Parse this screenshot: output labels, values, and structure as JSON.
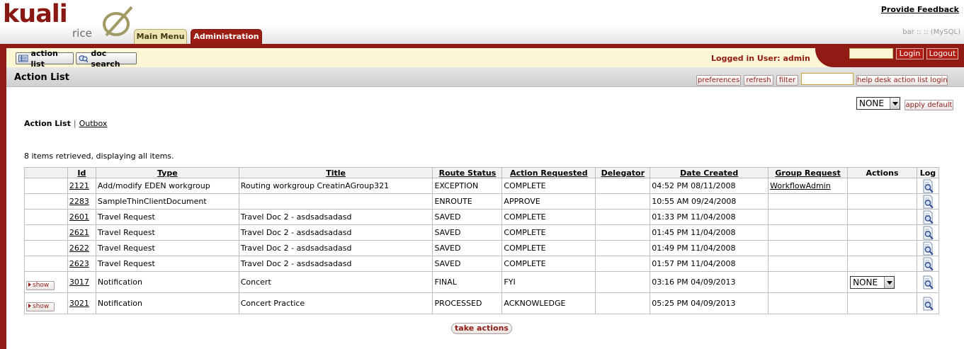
{
  "brand": {
    "name": "kuali",
    "suffix": "rice",
    "accent": "#8f1b14"
  },
  "header": {
    "feedback_link": "Provide Feedback",
    "environment": "bar :: :: (MySQL)",
    "tabs": [
      {
        "label": "Main Menu",
        "active": false
      },
      {
        "label": "Administration",
        "active": true
      }
    ]
  },
  "toolbar": {
    "action_list_button": "action list",
    "doc_search_button": "doc search",
    "logged_in_text": "Logged in User: admin",
    "login_button": "Login",
    "logout_button": "Logout",
    "login_input_value": ""
  },
  "titlebar": {
    "title": "Action List",
    "buttons": {
      "preferences": "preferences",
      "refresh": "refresh",
      "filter": "filter",
      "helpdesk": "help desk action list login"
    },
    "helpdesk_input_value": ""
  },
  "content": {
    "default_select": "NONE",
    "apply_default_button": "apply default",
    "subnav": {
      "current": "Action List",
      "separator": "|",
      "outbox": "Outbox"
    },
    "retrieved": "8 items retrieved, displaying all items.",
    "take_actions_button": "take actions"
  },
  "table": {
    "headers": {
      "id": "Id",
      "type": "Type",
      "title": "Title",
      "route_status": "Route Status",
      "action_requested": "Action Requested",
      "delegator": "Delegator",
      "date_created": "Date Created",
      "group_request": "Group Request",
      "actions": "Actions",
      "log": "Log"
    },
    "rows": [
      {
        "show": "",
        "id": "2121",
        "type": "Add/modify EDEN workgroup",
        "title": "Routing workgroup CreatinAGroup321",
        "route_status": "EXCEPTION",
        "action_requested": "COMPLETE",
        "delegator": "",
        "date_created": "04:52 PM 08/11/2008",
        "group_request": "WorkflowAdmin",
        "action_select": ""
      },
      {
        "show": "",
        "id": "2283",
        "type": "SampleThinClientDocument",
        "title": "",
        "route_status": "ENROUTE",
        "action_requested": "APPROVE",
        "delegator": "",
        "date_created": "10:55 AM 09/24/2008",
        "group_request": "",
        "action_select": ""
      },
      {
        "show": "",
        "id": "2601",
        "type": "Travel Request",
        "title": "Travel Doc 2 - asdsadsadasd",
        "route_status": "SAVED",
        "action_requested": "COMPLETE",
        "delegator": "",
        "date_created": "01:33 PM 11/04/2008",
        "group_request": "",
        "action_select": ""
      },
      {
        "show": "",
        "id": "2621",
        "type": "Travel Request",
        "title": "Travel Doc 2 - asdsadsadasd",
        "route_status": "SAVED",
        "action_requested": "COMPLETE",
        "delegator": "",
        "date_created": "01:45 PM 11/04/2008",
        "group_request": "",
        "action_select": ""
      },
      {
        "show": "",
        "id": "2622",
        "type": "Travel Request",
        "title": "Travel Doc 2 - asdsadsadasd",
        "route_status": "SAVED",
        "action_requested": "COMPLETE",
        "delegator": "",
        "date_created": "01:49 PM 11/04/2008",
        "group_request": "",
        "action_select": ""
      },
      {
        "show": "",
        "id": "2623",
        "type": "Travel Request",
        "title": "Travel Doc 2 - asdsadsadasd",
        "route_status": "SAVED",
        "action_requested": "COMPLETE",
        "delegator": "",
        "date_created": "01:57 PM 11/04/2008",
        "group_request": "",
        "action_select": ""
      },
      {
        "show": "show",
        "id": "3017",
        "type": "Notification",
        "title": "Concert",
        "route_status": "FINAL",
        "action_requested": "FYI",
        "delegator": "",
        "date_created": "03:16 PM 04/09/2013",
        "group_request": "",
        "action_select": "NONE"
      },
      {
        "show": "show",
        "id": "3021",
        "type": "Notification",
        "title": "Concert Practice",
        "route_status": "PROCESSED",
        "action_requested": "ACKNOWLEDGE",
        "delegator": "",
        "date_created": "05:25 PM 04/09/2013",
        "group_request": "",
        "action_select": ""
      }
    ],
    "log_icon": "log-magnifier-icon"
  }
}
